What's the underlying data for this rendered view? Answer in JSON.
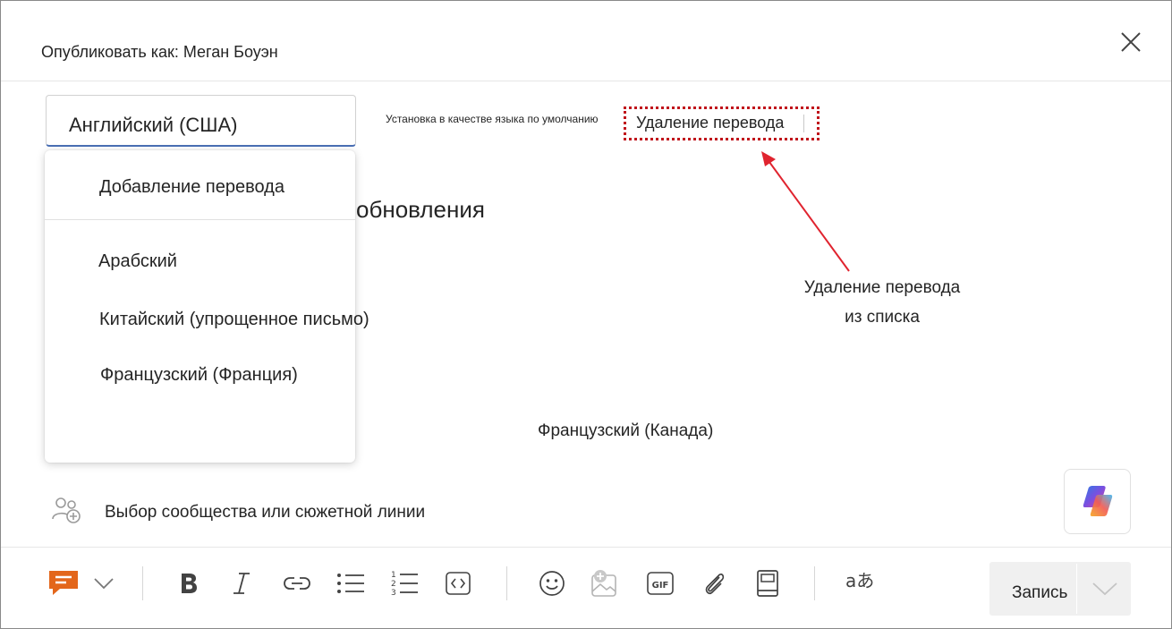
{
  "header": {
    "title": "Опубликовать как: Меган Боуэн",
    "close_icon": "close-icon"
  },
  "language_select": {
    "value": "Английский (США)"
  },
  "actions": {
    "set_default": "Установка в качестве языка по умолчанию",
    "remove_translation": "Удаление перевода"
  },
  "annotation": {
    "line1": "Удаление перевода",
    "line2": "из списка",
    "highlight_color": "#c0131b",
    "arrow_color": "#e0242f"
  },
  "background_heading": "обновления",
  "dropdown": {
    "add_translation": "Добавление перевода",
    "items": [
      {
        "label": "Арабский"
      },
      {
        "label": "Китайский (упрощенное письмо)"
      },
      {
        "label": "Французский (Франция)"
      }
    ]
  },
  "floating_item": "Французский (Канада)",
  "community": {
    "label": "Выбор сообщества или сюжетной линии",
    "icon": "community-add-icon"
  },
  "toolbar": {
    "icons": [
      "post-type-icon",
      "chevron-down-icon",
      "bold-icon",
      "italic-icon",
      "link-icon",
      "bullet-list-icon",
      "numbered-list-icon",
      "code-icon",
      "emoji-icon",
      "add-image-icon",
      "gif-icon",
      "attach-icon",
      "notebook-icon",
      "translate-icon"
    ],
    "gif_text": "GIF",
    "numbered_digits": [
      "1",
      "2",
      "3"
    ],
    "translate_glyph": "aあ",
    "accent_color": "#e3661b",
    "post_label": "Запись"
  }
}
